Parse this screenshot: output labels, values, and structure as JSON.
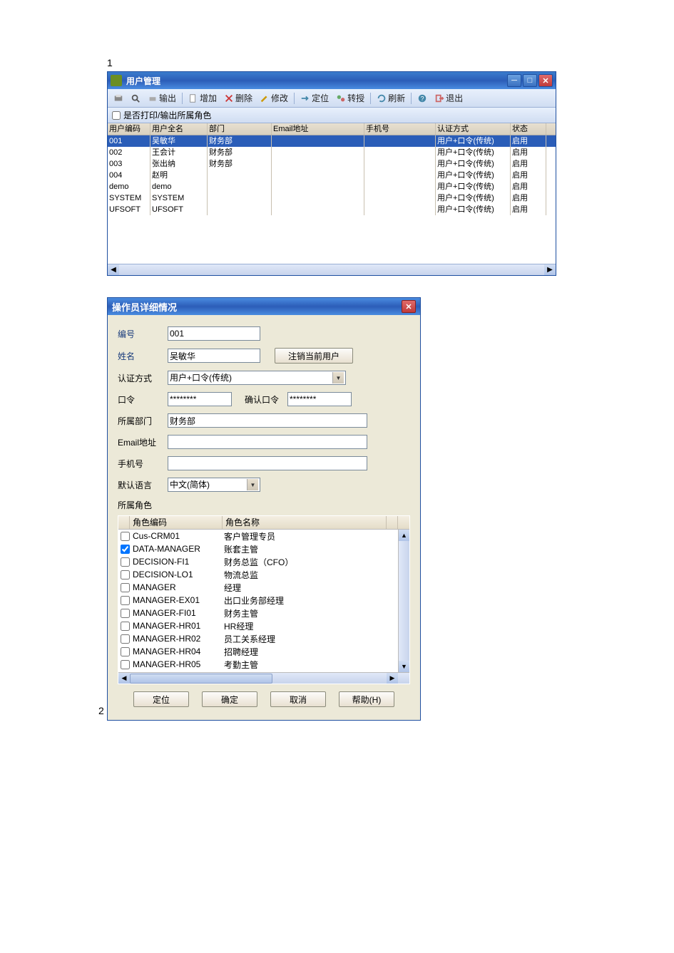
{
  "labels": {
    "one": "1",
    "two": "2"
  },
  "window1": {
    "title": "用户管理",
    "toolbar": {
      "print": "输出",
      "add": "增加",
      "delete": "删除",
      "modify": "修改",
      "locate": "定位",
      "transfer": "转授",
      "refresh": "刷新",
      "exit": "退出"
    },
    "subtoolbar": {
      "checkbox_label": "是否打印/输出所属角色"
    },
    "columns": [
      "用户编码",
      "用户全名",
      "部门",
      "Email地址",
      "手机号",
      "认证方式",
      "状态"
    ],
    "rows": [
      {
        "id": "001",
        "name": "吴敏华",
        "dept": "财务部",
        "email": "",
        "phone": "",
        "auth": "用户+口令(传统)",
        "status": "启用",
        "selected": true
      },
      {
        "id": "002",
        "name": "王会计",
        "dept": "财务部",
        "email": "",
        "phone": "",
        "auth": "用户+口令(传统)",
        "status": "启用"
      },
      {
        "id": "003",
        "name": "张出纳",
        "dept": "财务部",
        "email": "",
        "phone": "",
        "auth": "用户+口令(传统)",
        "status": "启用"
      },
      {
        "id": "004",
        "name": "赵明",
        "dept": "",
        "email": "",
        "phone": "",
        "auth": "用户+口令(传统)",
        "status": "启用"
      },
      {
        "id": "demo",
        "name": "demo",
        "dept": "",
        "email": "",
        "phone": "",
        "auth": "用户+口令(传统)",
        "status": "启用"
      },
      {
        "id": "SYSTEM",
        "name": "SYSTEM",
        "dept": "",
        "email": "",
        "phone": "",
        "auth": "用户+口令(传统)",
        "status": "启用"
      },
      {
        "id": "UFSOFT",
        "name": "UFSOFT",
        "dept": "",
        "email": "",
        "phone": "",
        "auth": "用户+口令(传统)",
        "status": "启用"
      }
    ]
  },
  "dialog": {
    "title": "操作员详细情况",
    "form": {
      "id_label": "编号",
      "id_value": "001",
      "name_label": "姓名",
      "name_value": "吴敏华",
      "deregister_btn": "注销当前用户",
      "auth_label": "认证方式",
      "auth_value": "用户+口令(传统)",
      "pwd_label": "口令",
      "pwd_value": "********",
      "confirm_pwd_label": "确认口令",
      "confirm_pwd_value": "********",
      "dept_label": "所属部门",
      "dept_value": "财务部",
      "email_label": "Email地址",
      "email_value": "",
      "phone_label": "手机号",
      "phone_value": "",
      "lang_label": "默认语言",
      "lang_value": "中文(简体)"
    },
    "roles": {
      "section_label": "所属角色",
      "columns": [
        "角色编码",
        "角色名称"
      ],
      "rows": [
        {
          "checked": false,
          "code": "Cus-CRM01",
          "name": "客户管理专员"
        },
        {
          "checked": true,
          "code": "DATA-MANAGER",
          "name": "账套主管"
        },
        {
          "checked": false,
          "code": "DECISION-FI1",
          "name": "财务总监（CFO）"
        },
        {
          "checked": false,
          "code": "DECISION-LO1",
          "name": "物流总监"
        },
        {
          "checked": false,
          "code": "MANAGER",
          "name": "经理"
        },
        {
          "checked": false,
          "code": "MANAGER-EX01",
          "name": "出口业务部经理"
        },
        {
          "checked": false,
          "code": "MANAGER-FI01",
          "name": "财务主管"
        },
        {
          "checked": false,
          "code": "MANAGER-HR01",
          "name": "HR经理"
        },
        {
          "checked": false,
          "code": "MANAGER-HR02",
          "name": "员工关系经理"
        },
        {
          "checked": false,
          "code": "MANAGER-HR04",
          "name": "招聘经理"
        },
        {
          "checked": false,
          "code": "MANAGER-HR05",
          "name": "考勤主管"
        }
      ]
    },
    "buttons": {
      "locate": "定位",
      "ok": "确定",
      "cancel": "取消",
      "help": "帮助(H)"
    }
  }
}
